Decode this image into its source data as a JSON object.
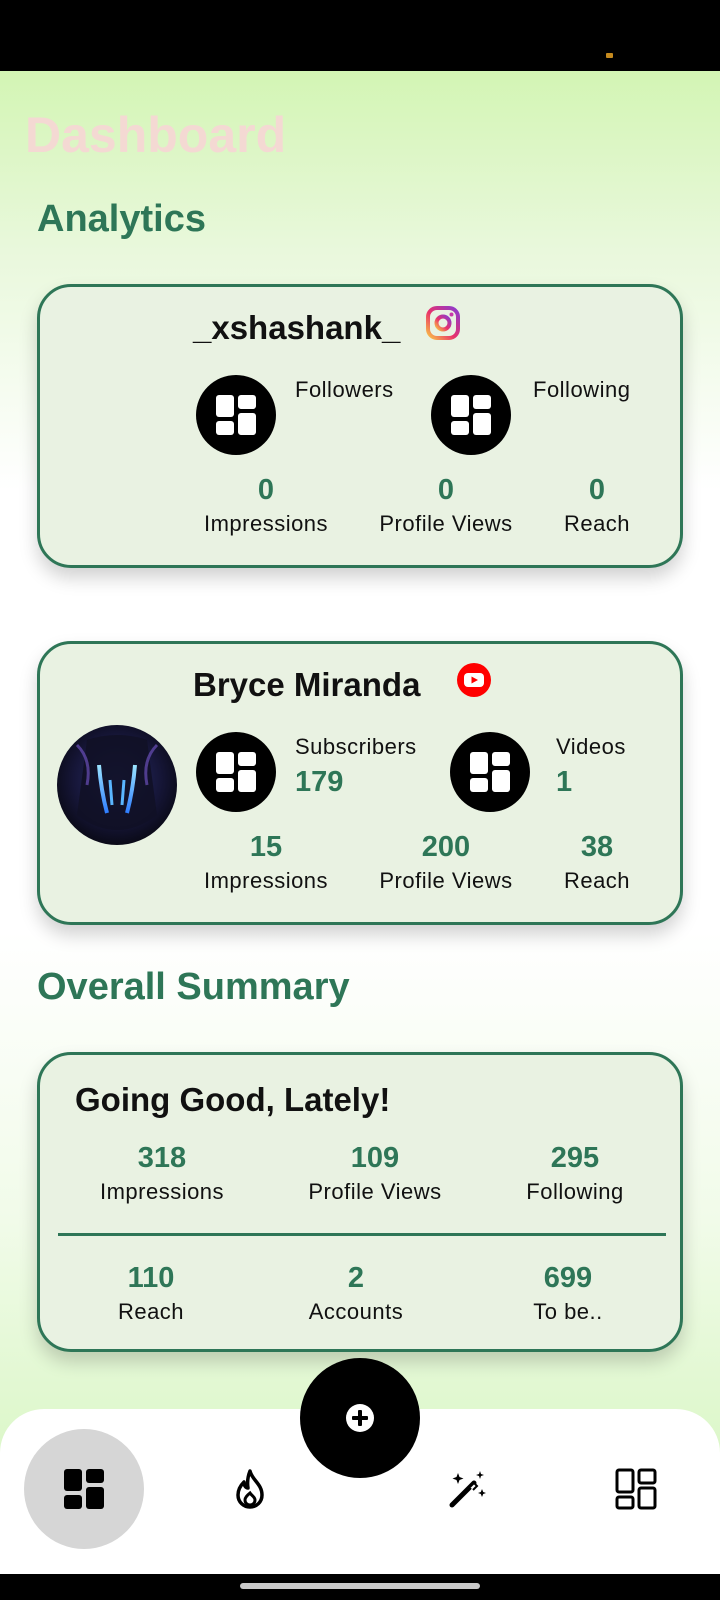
{
  "app": {
    "title": "Dashboard"
  },
  "sections": {
    "analytics": "Analytics",
    "overall": "Overall Summary"
  },
  "instagram": {
    "username": "_xshashank_",
    "platform_icon": "instagram-icon",
    "followers_label": "Followers",
    "followers_value": "",
    "following_label": "Following",
    "following_value": "",
    "stats": [
      {
        "value": "0",
        "label": "Impressions"
      },
      {
        "value": "0",
        "label": "Profile Views"
      },
      {
        "value": "0",
        "label": "Reach"
      }
    ]
  },
  "youtube": {
    "channel": "Bryce Miranda",
    "platform_icon": "youtube-icon",
    "subscribers_label": "Subscribers",
    "subscribers_value": "179",
    "videos_label": "Videos",
    "videos_value": "1",
    "stats": [
      {
        "value": "15",
        "label": "Impressions"
      },
      {
        "value": "200",
        "label": "Profile Views"
      },
      {
        "value": "38",
        "label": "Reach"
      }
    ]
  },
  "summary": {
    "heading": "Going Good, Lately!",
    "row1": [
      {
        "value": "318",
        "label": "Impressions"
      },
      {
        "value": "109",
        "label": "Profile Views"
      },
      {
        "value": "295",
        "label": "Following"
      }
    ],
    "row2": [
      {
        "value": "110",
        "label": "Reach"
      },
      {
        "value": "2",
        "label": "Accounts"
      },
      {
        "value": "699",
        "label": "To be.."
      }
    ]
  },
  "nav": {
    "items": [
      "dashboard-icon",
      "flame-icon",
      "magic-wand-icon",
      "grid-icon"
    ],
    "active_index": 0,
    "fab_icon": "plus-icon"
  },
  "colors": {
    "accent": "#2e7657",
    "card_bg": "#e9f2e2",
    "title_faded": "#f4d9d3",
    "youtube_red": "#ff0000",
    "nav_active_bg": "#d6d6d6"
  }
}
